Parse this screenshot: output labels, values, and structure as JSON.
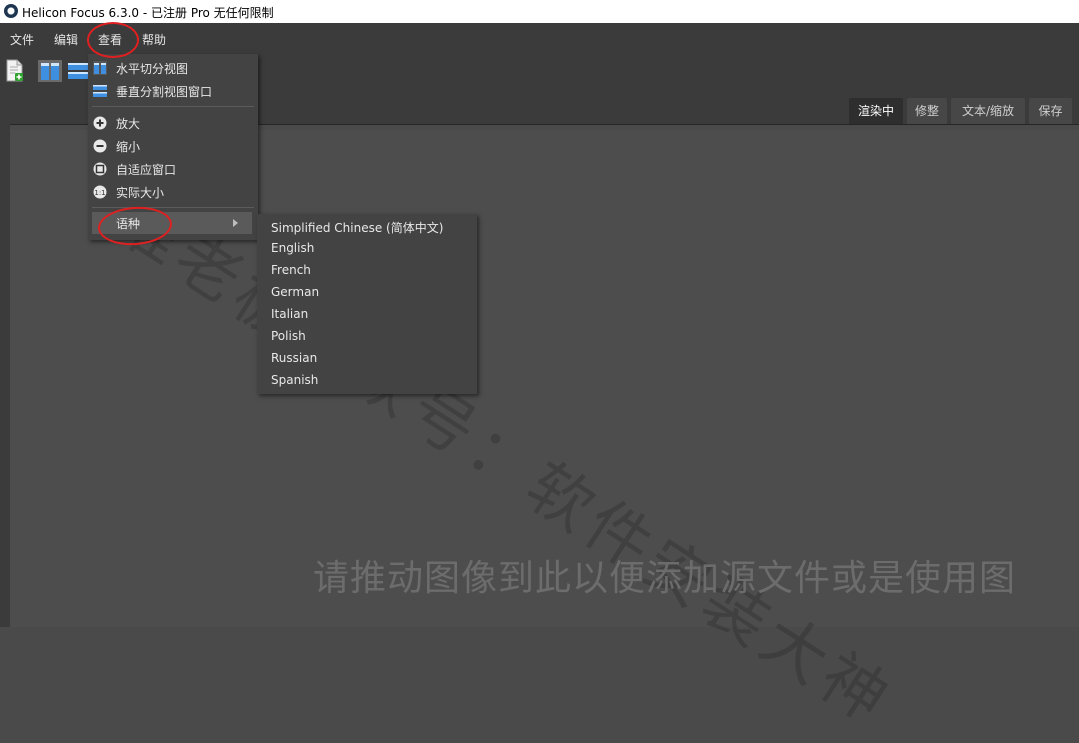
{
  "window": {
    "title": "Helicon Focus 6.3.0 - 已注册 Pro 无任何限制"
  },
  "menubar": {
    "items": [
      "文件",
      "编辑",
      "查看",
      "帮助"
    ]
  },
  "tabs": [
    {
      "label": "渲染中",
      "active": true
    },
    {
      "label": "修整",
      "active": false
    },
    {
      "label": "文本/缩放",
      "active": false
    },
    {
      "label": "保存",
      "active": false
    }
  ],
  "view_menu": {
    "items": [
      {
        "label": "水平切分视图",
        "icon": "horizontal-split-icon"
      },
      {
        "label": "垂直分割视图窗口",
        "icon": "vertical-split-icon"
      },
      {
        "label": "放大",
        "icon": "zoom-in-icon"
      },
      {
        "label": "缩小",
        "icon": "zoom-out-icon"
      },
      {
        "label": "自适应窗口",
        "icon": "fit-window-icon"
      },
      {
        "label": "实际大小",
        "icon": "actual-size-icon"
      },
      {
        "label": "语种",
        "icon": "",
        "has_submenu": true,
        "highlighted": true
      }
    ]
  },
  "language_submenu": {
    "items": [
      "Simplified Chinese (简体中文)",
      "English",
      "French",
      "German",
      "Italian",
      "Polish",
      "Russian",
      "Spanish"
    ]
  },
  "main": {
    "drop_hint": "请推动图像到此以便添加源文件或是使用图"
  },
  "watermark": "淮老板公众号：软件安装大神",
  "colors": {
    "annotation": "#e02020",
    "menu_bg": "#434343",
    "app_bg": "#3b3b3b"
  }
}
